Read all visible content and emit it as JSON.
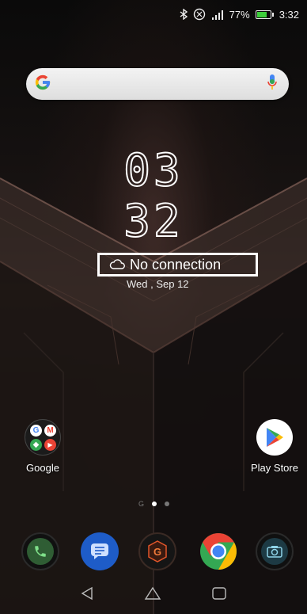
{
  "status_bar": {
    "battery_text": "77%",
    "time": "3:32",
    "battery_level": 0.77,
    "icons": [
      "bluetooth-icon",
      "nfc-icon",
      "signal-icon",
      "battery-icon"
    ]
  },
  "search": {
    "icons": [
      "google-logo-icon",
      "mic-icon"
    ],
    "logo_text": "G"
  },
  "clock": {
    "hours": "03",
    "minutes": "32"
  },
  "weather": {
    "text": "No connection",
    "icon": "cloud-icon",
    "date": "Wed , Sep 12"
  },
  "apps": {
    "google_folder_label": "Google",
    "play_store_label": "Play Store"
  },
  "pager": {
    "google_label": "G",
    "pages": 2,
    "active_page": 1
  },
  "dock": {
    "items": [
      "phone-icon",
      "messages-icon",
      "game-genie-icon",
      "chrome-icon",
      "camera-icon"
    ]
  },
  "nav": {
    "buttons": [
      "back-icon",
      "home-icon",
      "recents-icon"
    ]
  },
  "colors": {
    "accent_green": "#3ccf3a",
    "google_blue": "#4285f4",
    "google_red": "#ea4335",
    "google_yellow": "#fbbc05",
    "google_green": "#34a853"
  }
}
